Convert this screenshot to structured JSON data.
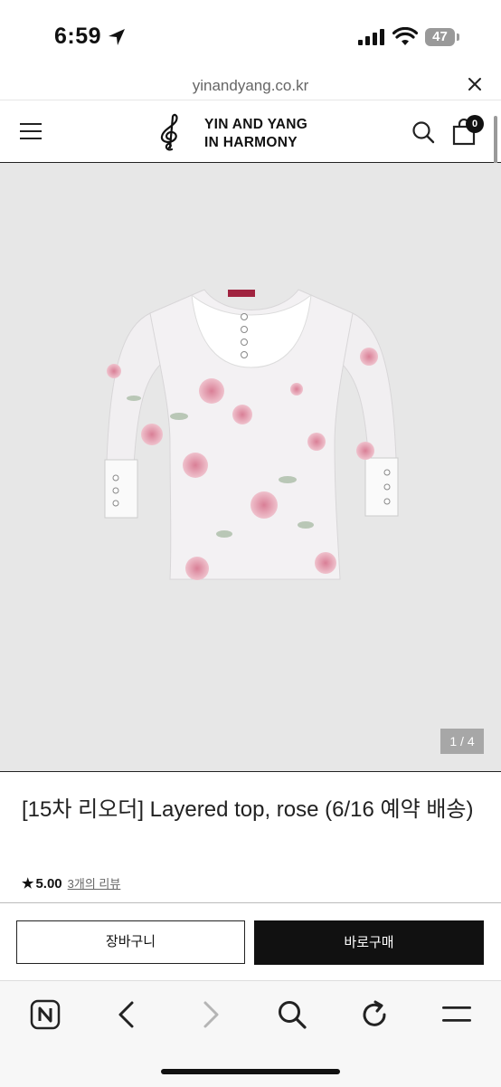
{
  "status_bar": {
    "time": "6:59",
    "battery": "47"
  },
  "browser": {
    "url": "yinandyang.co.kr"
  },
  "header": {
    "brand_line1": "YIN AND YANG",
    "brand_line2": "IN HARMONY",
    "cart_count": "0"
  },
  "gallery": {
    "counter": "1 / 4"
  },
  "product": {
    "title": "[15차 리오더] Layered top, rose (6/16 예약 배송)",
    "star": "★",
    "rating": "5.00",
    "reviews": "3개의 리뷰"
  },
  "actions": {
    "cart_label": "장바구니",
    "buy_label": "바로구매"
  },
  "icons": {
    "toolbar": [
      "naver-icon",
      "back-icon",
      "forward-icon",
      "search-icon",
      "reload-icon",
      "menu-icon"
    ]
  },
  "colors": {
    "accent": "#111111",
    "gallery_bg": "#e7e7e7",
    "counter_bg": "#a7a7a7"
  }
}
